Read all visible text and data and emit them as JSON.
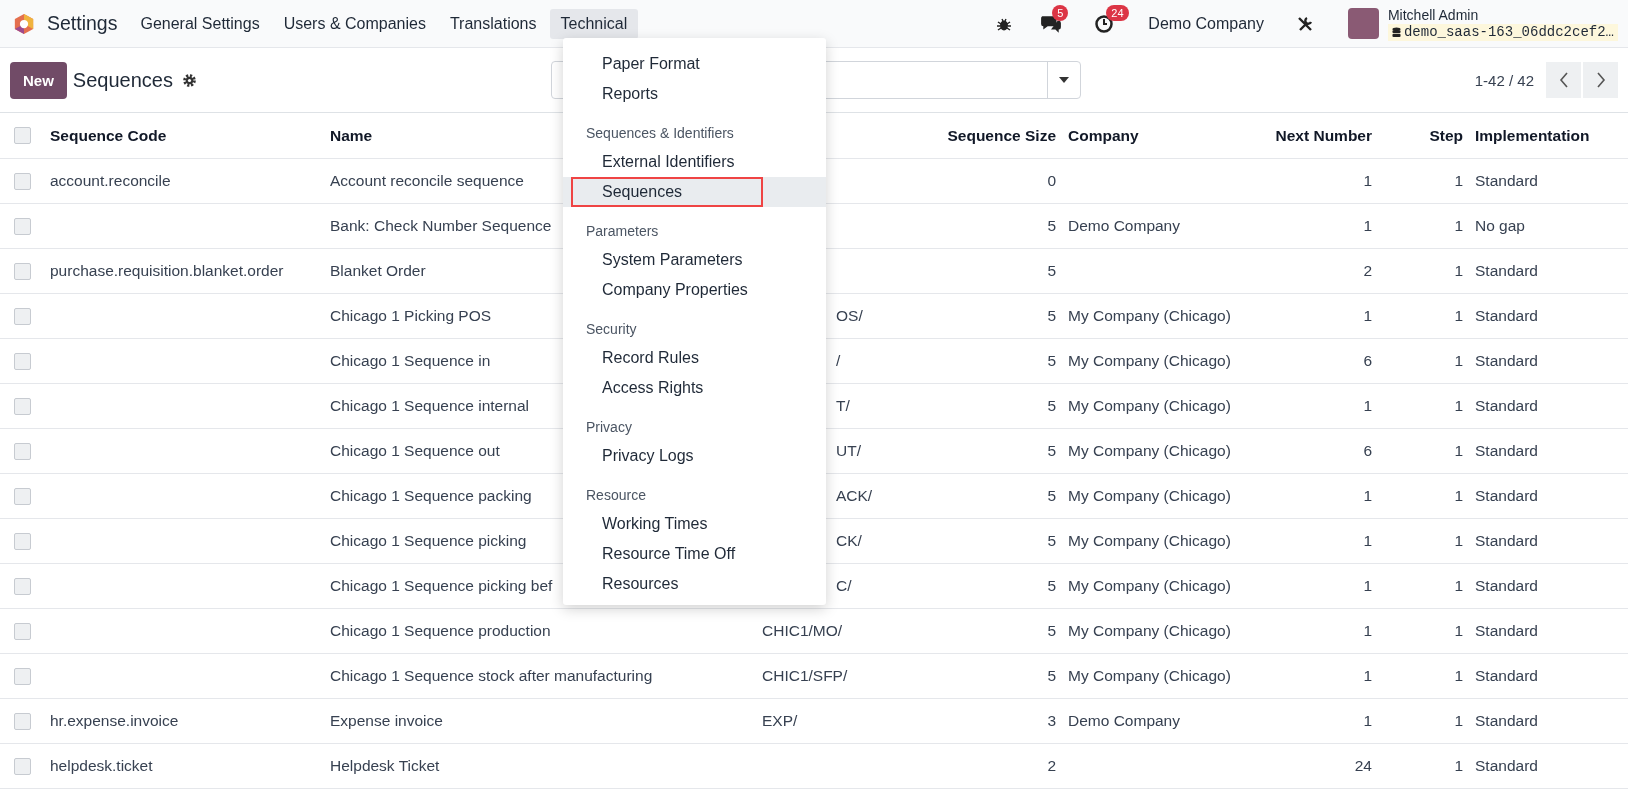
{
  "navbar": {
    "app_name": "Settings",
    "menus": [
      {
        "label": "General Settings",
        "selected": false
      },
      {
        "label": "Users & Companies",
        "selected": false
      },
      {
        "label": "Translations",
        "selected": false
      },
      {
        "label": "Technical",
        "selected": true
      }
    ],
    "messages_badge": "5",
    "activities_badge": "24",
    "company": "Demo Company",
    "user": {
      "name": "Mitchell Admin",
      "database": "demo_saas-163_06ddc2cef2…"
    }
  },
  "control_panel": {
    "new_button": "New",
    "title": "Sequences",
    "pager": "1-42 / 42"
  },
  "table": {
    "all_checked": false,
    "columns": [
      {
        "label": "Sequence Code"
      },
      {
        "label": "Name"
      },
      {
        "label": "Sequence Size"
      },
      {
        "label": "Company"
      },
      {
        "label": "Next Number"
      },
      {
        "label": "Step"
      },
      {
        "label": "Implementation"
      }
    ],
    "rows": [
      {
        "checked": false,
        "code": "account.reconcile",
        "name": "Account reconcile sequence",
        "size": "0",
        "company": "",
        "next": "1",
        "step": "1",
        "implementation": "Standard"
      },
      {
        "checked": false,
        "code": "",
        "name": "Bank: Check Number Sequence",
        "size": "5",
        "company": "Demo Company",
        "next": "1",
        "step": "1",
        "implementation": "No gap"
      },
      {
        "checked": false,
        "code": "purchase.requisition.blanket.order",
        "name": "Blanket Order",
        "size": "5",
        "company": "",
        "next": "2",
        "step": "1",
        "implementation": "Standard"
      },
      {
        "checked": false,
        "code": "",
        "name": "Chicago 1 Picking POS",
        "prefix_tail": "OS/",
        "size": "5",
        "company": "My Company (Chicago)",
        "next": "1",
        "step": "1",
        "implementation": "Standard"
      },
      {
        "checked": false,
        "code": "",
        "name": "Chicago 1 Sequence in",
        "prefix_tail": "/",
        "size": "5",
        "company": "My Company (Chicago)",
        "next": "6",
        "step": "1",
        "implementation": "Standard"
      },
      {
        "checked": false,
        "code": "",
        "name": "Chicago 1 Sequence internal",
        "prefix_tail": "T/",
        "size": "5",
        "company": "My Company (Chicago)",
        "next": "1",
        "step": "1",
        "implementation": "Standard"
      },
      {
        "checked": false,
        "code": "",
        "name": "Chicago 1 Sequence out",
        "prefix_tail": "UT/",
        "size": "5",
        "company": "My Company (Chicago)",
        "next": "6",
        "step": "1",
        "implementation": "Standard"
      },
      {
        "checked": false,
        "code": "",
        "name": "Chicago 1 Sequence packing",
        "prefix_tail": "ACK/",
        "size": "5",
        "company": "My Company (Chicago)",
        "next": "1",
        "step": "1",
        "implementation": "Standard"
      },
      {
        "checked": false,
        "code": "",
        "name": "Chicago 1 Sequence picking",
        "prefix_tail": "CK/",
        "size": "5",
        "company": "My Company (Chicago)",
        "next": "1",
        "step": "1",
        "implementation": "Standard"
      },
      {
        "checked": false,
        "code": "",
        "name": "Chicago 1 Sequence picking bef",
        "prefix_tail": "C/",
        "size": "5",
        "company": "My Company (Chicago)",
        "next": "1",
        "step": "1",
        "implementation": "Standard"
      },
      {
        "checked": false,
        "code": "",
        "name": "Chicago 1 Sequence production",
        "prefix": "CHIC1/MO/",
        "size": "5",
        "company": "My Company (Chicago)",
        "next": "1",
        "step": "1",
        "implementation": "Standard"
      },
      {
        "checked": false,
        "code": "",
        "name": "Chicago 1 Sequence stock after manufacturing",
        "prefix": "CHIC1/SFP/",
        "size": "5",
        "company": "My Company (Chicago)",
        "next": "1",
        "step": "1",
        "implementation": "Standard"
      },
      {
        "checked": false,
        "code": "hr.expense.invoice",
        "name": "Expense invoice",
        "prefix": "EXP/",
        "size": "3",
        "company": "Demo Company",
        "next": "1",
        "step": "1",
        "implementation": "Standard"
      },
      {
        "checked": false,
        "code": "helpdesk.ticket",
        "name": "Helpdesk Ticket",
        "size": "2",
        "company": "",
        "next": "24",
        "step": "1",
        "implementation": "Standard"
      }
    ]
  },
  "technical_menu": [
    {
      "kind": "item",
      "label": "Paper Format",
      "selected": false
    },
    {
      "kind": "item",
      "label": "Reports",
      "selected": false
    },
    {
      "kind": "header",
      "label": "Sequences & Identifiers"
    },
    {
      "kind": "item",
      "label": "External Identifiers",
      "selected": false
    },
    {
      "kind": "item",
      "label": "Sequences",
      "selected": true
    },
    {
      "kind": "header",
      "label": "Parameters"
    },
    {
      "kind": "item",
      "label": "System Parameters",
      "selected": false
    },
    {
      "kind": "item",
      "label": "Company Properties",
      "selected": false
    },
    {
      "kind": "header",
      "label": "Security"
    },
    {
      "kind": "item",
      "label": "Record Rules",
      "selected": false
    },
    {
      "kind": "item",
      "label": "Access Rights",
      "selected": false
    },
    {
      "kind": "header",
      "label": "Privacy"
    },
    {
      "kind": "item",
      "label": "Privacy Logs",
      "selected": false
    },
    {
      "kind": "header",
      "label": "Resource"
    },
    {
      "kind": "item",
      "label": "Working Times",
      "selected": false
    },
    {
      "kind": "item",
      "label": "Resource Time Off",
      "selected": false
    },
    {
      "kind": "item",
      "label": "Resources",
      "selected": false
    }
  ]
}
